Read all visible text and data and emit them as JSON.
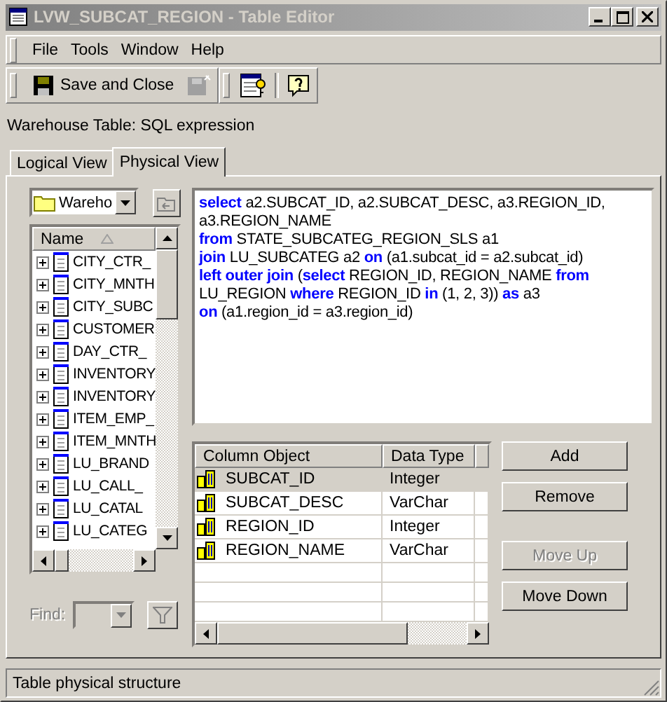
{
  "window": {
    "title": "LVW_SUBCAT_REGION - Table Editor"
  },
  "menu": [
    "File",
    "Tools",
    "Window",
    "Help"
  ],
  "toolbar": {
    "save_label": "Save and Close"
  },
  "caption": "Warehouse Table: SQL expression",
  "tabs": [
    {
      "label": "Logical View",
      "selected": false
    },
    {
      "label": "Physical View",
      "selected": true
    }
  ],
  "source_dropdown": {
    "value": "Wareho"
  },
  "tree": {
    "header": "Name",
    "items": [
      "CITY_CTR_",
      "CITY_MNTH",
      "CITY_SUBC",
      "CUSTOMER",
      "DAY_CTR_",
      "INVENTORY",
      "INVENTORY",
      "ITEM_EMP_",
      "ITEM_MNTH",
      "LU_BRAND",
      "LU_CALL_",
      "LU_CATAL",
      "LU_CATEG"
    ]
  },
  "find": {
    "label": "Find:",
    "disabled": true
  },
  "sql": [
    [
      {
        "text": "select",
        "keyword": true
      },
      {
        "text": " a2.SUBCAT_ID, a2.SUBCAT_DESC, a3.REGION_ID,",
        "keyword": false
      }
    ],
    [
      {
        "text": "a3.REGION_NAME",
        "keyword": false
      }
    ],
    [
      {
        "text": "from",
        "keyword": true
      },
      {
        "text": " STATE_SUBCATEG_REGION_SLS a1",
        "keyword": false
      }
    ],
    [
      {
        "text": "join",
        "keyword": true
      },
      {
        "text": " LU_SUBCATEG a2 ",
        "keyword": false
      },
      {
        "text": "on",
        "keyword": true
      },
      {
        "text": " (a1.subcat_id = a2.subcat_id)",
        "keyword": false
      }
    ],
    [
      {
        "text": "left outer join",
        "keyword": true
      },
      {
        "text": " (",
        "keyword": false
      },
      {
        "text": "select",
        "keyword": true
      },
      {
        "text": " REGION_ID, REGION_NAME ",
        "keyword": false
      },
      {
        "text": "from",
        "keyword": true
      }
    ],
    [
      {
        "text": "LU_REGION ",
        "keyword": false
      },
      {
        "text": "where",
        "keyword": true
      },
      {
        "text": " REGION_ID ",
        "keyword": false
      },
      {
        "text": "in",
        "keyword": true
      },
      {
        "text": " (1, 2, 3)) ",
        "keyword": false
      },
      {
        "text": "as",
        "keyword": true
      },
      {
        "text": " a3",
        "keyword": false
      }
    ],
    [
      {
        "text": "on",
        "keyword": true
      },
      {
        "text": " (a1.region_id = a3.region_id)",
        "keyword": false
      }
    ]
  ],
  "grid": {
    "columns": [
      "Column Object",
      "Data Type"
    ],
    "rows": [
      {
        "name": "SUBCAT_ID",
        "type": "Integer",
        "selected": true
      },
      {
        "name": "SUBCAT_DESC",
        "type": "VarChar",
        "selected": false
      },
      {
        "name": "REGION_ID",
        "type": "Integer",
        "selected": false
      },
      {
        "name": "REGION_NAME",
        "type": "VarChar",
        "selected": false
      }
    ]
  },
  "buttons": [
    {
      "label": "Add",
      "disabled": false
    },
    {
      "label": "Remove",
      "disabled": false
    },
    {
      "label": "Move Up",
      "disabled": true
    },
    {
      "label": "Move Down",
      "disabled": false
    }
  ],
  "status_bar": "Table physical structure"
}
